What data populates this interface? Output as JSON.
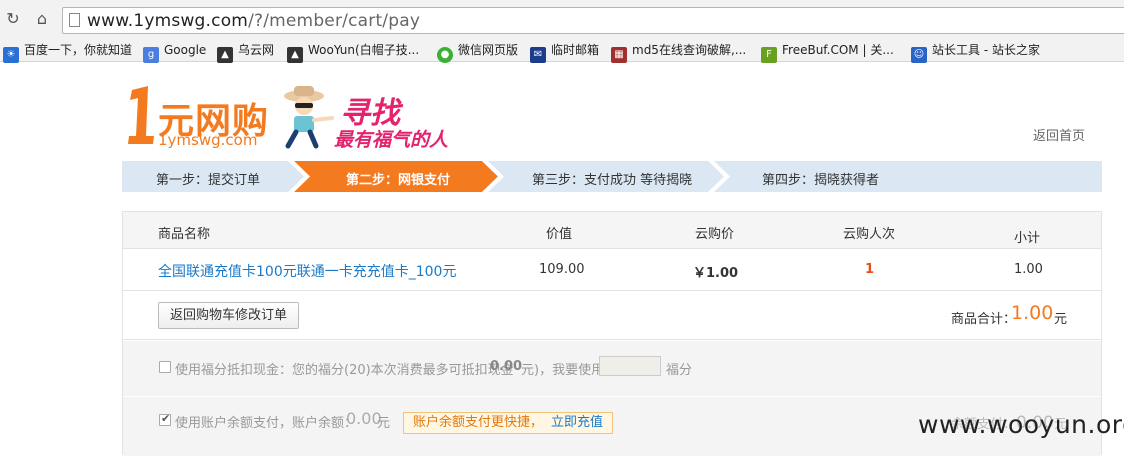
{
  "browser": {
    "url_host": "www.1ymswg.com",
    "url_path": "/?/member/cart/pay",
    "bookmarks": [
      {
        "label": "百度一下，你就知道",
        "icon": "paw-icon",
        "color": "#2a6fd6"
      },
      {
        "label": "Google",
        "icon": "google-icon",
        "color": "#4a7fe0"
      },
      {
        "label": "乌云网",
        "icon": "wooyun-icon",
        "color": "#333333"
      },
      {
        "label": "WooYun(白帽子技...",
        "icon": "wooyun-icon",
        "color": "#333333"
      },
      {
        "label": "微信网页版",
        "icon": "wechat-icon",
        "color": "#3cb035"
      },
      {
        "label": "临时邮箱",
        "icon": "mail-icon",
        "color": "#1c3c8c"
      },
      {
        "label": "md5在线查询破解,...",
        "icon": "grid-icon",
        "color": "#a03030"
      },
      {
        "label": "FreeBuf.COM | 关...",
        "icon": "freebuf-icon",
        "color": "#6aa020"
      },
      {
        "label": "站长工具 - 站长之家",
        "icon": "chinaz-icon",
        "color": "#2b64c8"
      }
    ]
  },
  "header": {
    "logo_text": "元网购",
    "logo_sub": "1ymswg.com",
    "slogan_main": "寻找",
    "slogan_sub": "最有福气的人",
    "home_link": "返回首页"
  },
  "steps": [
    {
      "label": "第一步：提交订单",
      "active": false
    },
    {
      "label": "第二步：网银支付",
      "active": true
    },
    {
      "label": "第三步：支付成功 等待揭晓",
      "active": false
    },
    {
      "label": "第四步：揭晓获得者",
      "active": false
    }
  ],
  "colors": {
    "accent": "#f47a20",
    "step_bg": "#dbe8f4",
    "link": "#1a7ac8"
  },
  "cart": {
    "columns": [
      "商品名称",
      "价值",
      "云购价",
      "云购人次",
      "小计"
    ],
    "rows": [
      {
        "name": "全国联通充值卡100元联通一卡充充值卡_100元",
        "value": "109.00",
        "price": "￥1.00",
        "count": "1",
        "subtotal": "1.00"
      }
    ],
    "back_button": "返回购物车修改订单",
    "total_label": "商品合计：",
    "total_value": "1.00",
    "total_unit": "元"
  },
  "payment": {
    "points_text": "使用福分抵扣现金：您的福分(20)本次消费最多可抵扣现金",
    "points_cash": "0.00",
    "points_tail": "元)，我要使用",
    "points_unit": "福分",
    "balance_text": "使用账户余额支付，账户余额：",
    "balance_value": "0.00",
    "balance_unit": "元",
    "tip_text": "账户余额支付更快捷，",
    "tip_link": "立即充值",
    "balance_pay_label": "余额支付：",
    "balance_pay_value": "0.00",
    "balance_pay_unit": "元"
  },
  "watermark": "www.wooyun.org"
}
